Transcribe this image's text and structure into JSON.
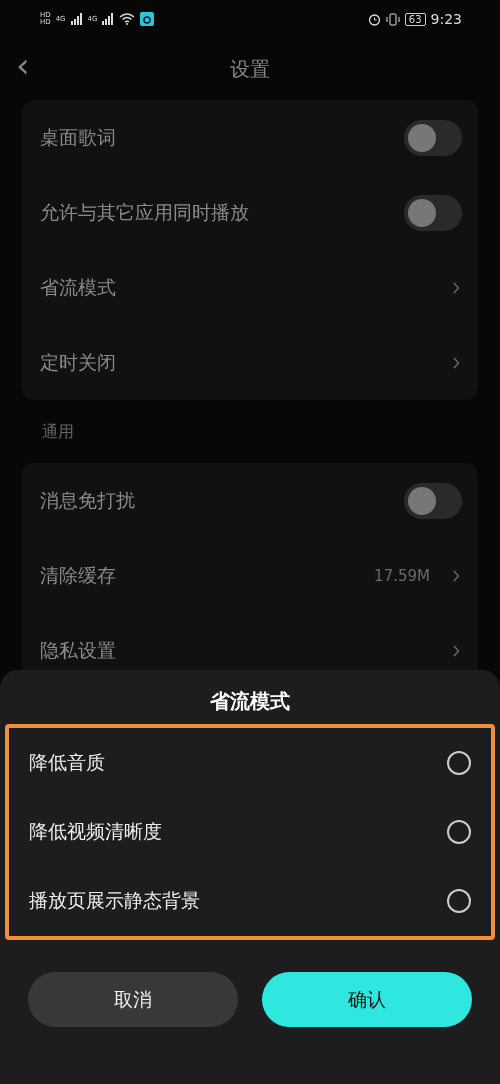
{
  "status_bar": {
    "left": [
      "HD",
      "HD",
      "4G",
      "4G"
    ],
    "battery": "63",
    "time": "9:23"
  },
  "header": {
    "back": "‹",
    "title": "设置"
  },
  "sections": [
    {
      "items": [
        {
          "kind": "toggle",
          "label": "桌面歌词",
          "on": false
        },
        {
          "kind": "toggle",
          "label": "允许与其它应用同时播放",
          "on": false
        },
        {
          "kind": "link",
          "label": "省流模式"
        },
        {
          "kind": "link",
          "label": "定时关闭"
        }
      ]
    },
    {
      "label": "通用",
      "items": [
        {
          "kind": "toggle",
          "label": "消息免打扰",
          "on": false
        },
        {
          "kind": "link",
          "label": "清除缓存",
          "value": "17.59M"
        },
        {
          "kind": "link",
          "label": "隐私设置"
        }
      ]
    }
  ],
  "sheet": {
    "title": "省流模式",
    "highlighted": true,
    "options": [
      {
        "label": "降低音质",
        "checked": false
      },
      {
        "label": "降低视频清晰度",
        "checked": false
      },
      {
        "label": "播放页展示静态背景",
        "checked": false
      }
    ],
    "cancel": "取消",
    "confirm": "确认"
  }
}
